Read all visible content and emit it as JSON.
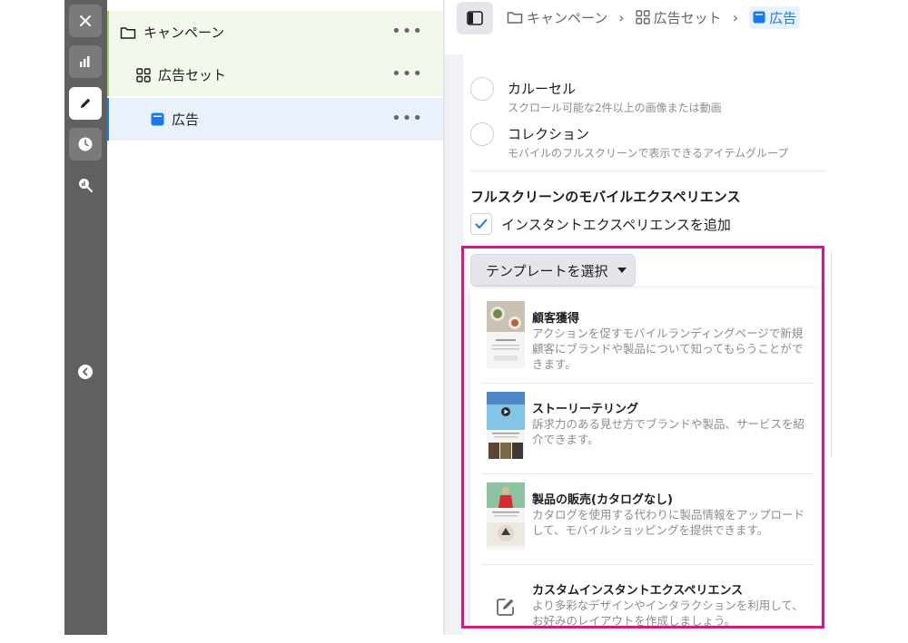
{
  "tree": {
    "campaign": "キャンペーン",
    "adset": "広告セット",
    "ad": "広告",
    "more": "•••"
  },
  "breadcrumb": {
    "campaign": "キャンペーン",
    "adset": "広告セット",
    "ad": "広告",
    "sep": "›"
  },
  "formats": [
    {
      "title": "カルーセル",
      "desc": "スクロール可能な2件以上の画像または動画"
    },
    {
      "title": "コレクション",
      "desc": "モバイルのフルスクリーンで表示できるアイテムグループ"
    }
  ],
  "fullscreen": {
    "heading": "フルスクリーンのモバイルエクスペリエンス",
    "checkbox_label": "インスタントエクスペリエンスを追加",
    "checked": true
  },
  "template": {
    "button_label": "テンプレートを選択",
    "items": [
      {
        "title": "顧客獲得",
        "desc": "アクションを促すモバイルランディングページで新規顧客にブランドや製品について知ってもらうことができます。",
        "thumb": "food-thumbnail"
      },
      {
        "title": "ストーリーテリング",
        "desc": "訴求力のある見せ方でブランドや製品、サービスを紹介できます。",
        "thumb": "pool-thumbnail"
      },
      {
        "title": "製品の販売(カタログなし)",
        "desc": "カタログを使用する代わりに製品情報をアップロードして、モバイルショッピングを提供できます。",
        "thumb": "fashion-thumbnail"
      },
      {
        "title": "カスタムインスタントエクスペリエンス",
        "desc": "より多彩なデザインやインタラクションを利用して、お好みのレイアウトを作成しましょう。",
        "thumb": "edit-icon"
      }
    ]
  },
  "colors": {
    "highlight": "#d6168b",
    "accent": "#1877f2",
    "rail": "#606060"
  }
}
